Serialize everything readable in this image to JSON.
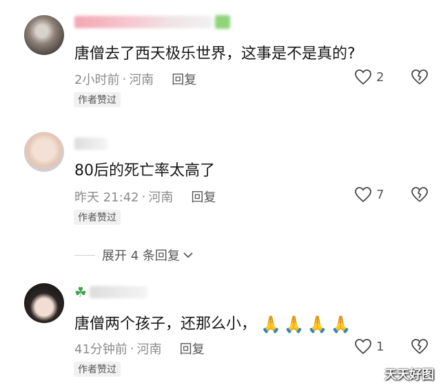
{
  "comments": [
    {
      "text": "唐僧去了西天极乐世界，这事是不是真的?",
      "time": "2小时前",
      "location": "河南",
      "reply_label": "回复",
      "likes": "2",
      "badge": "作者赞过"
    },
    {
      "text": "80后的死亡率太高了",
      "time": "昨天 21:42",
      "location": "河南",
      "reply_label": "回复",
      "likes": "7",
      "badge": "作者赞过"
    },
    {
      "text": "唐僧两个孩子，还那么小，",
      "emojis": [
        "🙏",
        "🙏",
        "🙏",
        "🙏"
      ],
      "time": "41分钟前",
      "location": "河南",
      "reply_label": "回复",
      "likes": "1",
      "badge": "作者赞过"
    }
  ],
  "expand_replies": "展开 4 条回复",
  "separator": "·",
  "watermark": "天天好图",
  "icons": {
    "like": "heart-outline-icon",
    "dislike": "broken-heart-icon",
    "expand": "chevron-down-icon",
    "username_badge": "clover-icon"
  },
  "colors": {
    "text": "#161616",
    "meta": "#8a8a8a",
    "badge_bg": "#f1f1f1"
  }
}
